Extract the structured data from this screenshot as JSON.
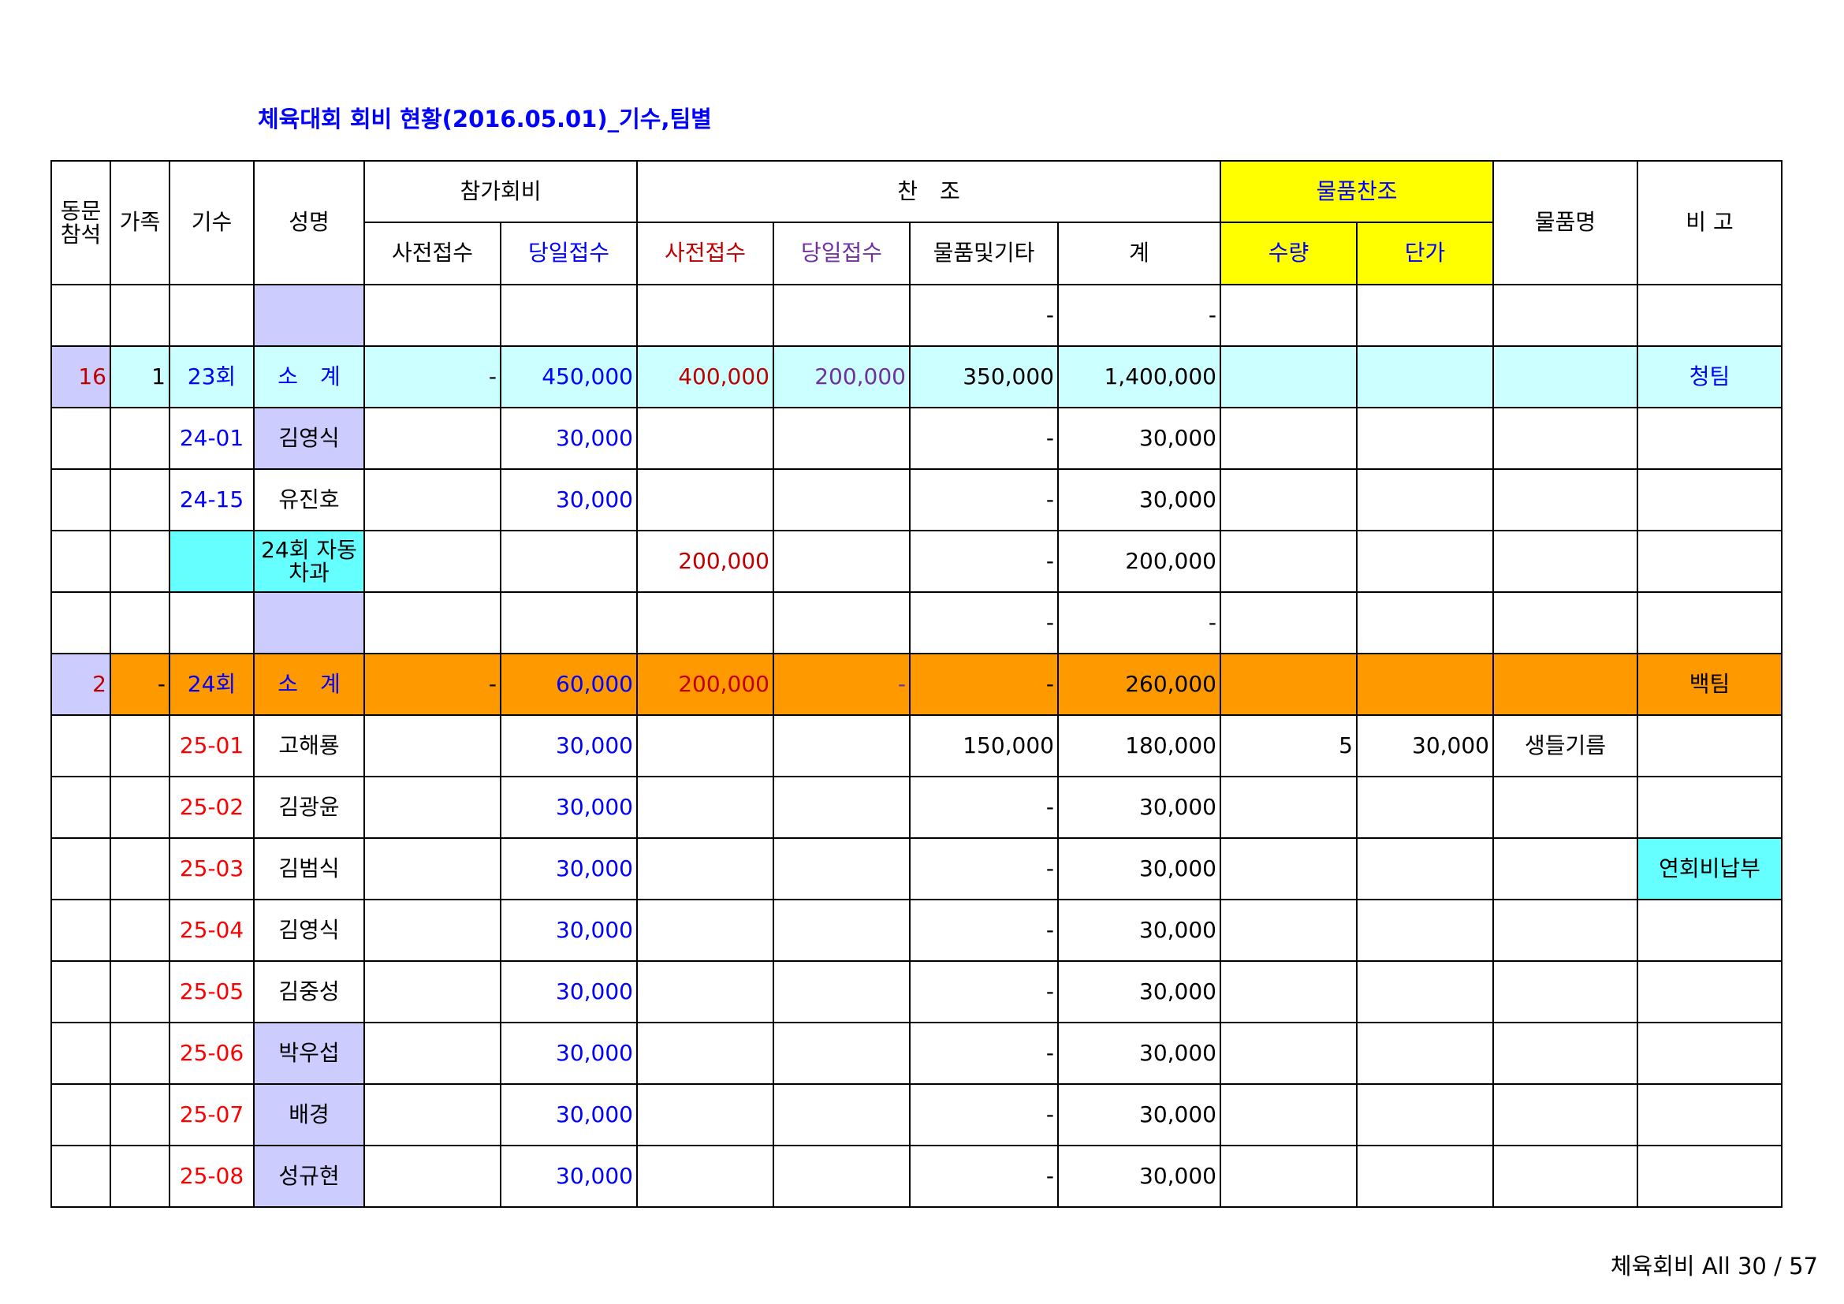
{
  "title": "체육대회 회비 현황(2016.05.01)_기수,팀별",
  "headers": {
    "attend": "동문\n참석",
    "family": "가족",
    "gisu": "기수",
    "name": "성명",
    "fee_group": "참가회비",
    "fee_pre": "사전접수",
    "fee_day": "당일접수",
    "sponsor_group": "찬　조",
    "sp_pre": "사전접수",
    "sp_day": "당일접수",
    "sp_goods": "물품및기타",
    "sp_total": "계",
    "goods_group": "물품찬조",
    "qty": "수량",
    "unit_price": "단가",
    "goods_name": "물품명",
    "remark": "비 고"
  },
  "rows": [
    {
      "a": "",
      "f": "",
      "g": "",
      "n": "",
      "fp": "",
      "fd": "",
      "sp": "",
      "sd": "",
      "go": "-",
      "t": "-",
      "q": "",
      "u": "",
      "gn": "",
      "rm": ""
    },
    {
      "a": "16",
      "f": "1",
      "g": "23회",
      "n": "소　계",
      "fp": "-",
      "fd": "450,000",
      "sp": "400,000",
      "sd": "200,000",
      "go": "350,000",
      "t": "1,400,000",
      "q": "",
      "u": "",
      "gn": "",
      "rm": "청팀"
    },
    {
      "a": "",
      "f": "",
      "g": "24-01",
      "n": "김영식",
      "fp": "",
      "fd": "30,000",
      "sp": "",
      "sd": "",
      "go": "-",
      "t": "30,000",
      "q": "",
      "u": "",
      "gn": "",
      "rm": ""
    },
    {
      "a": "",
      "f": "",
      "g": "24-15",
      "n": "유진호",
      "fp": "",
      "fd": "30,000",
      "sp": "",
      "sd": "",
      "go": "-",
      "t": "30,000",
      "q": "",
      "u": "",
      "gn": "",
      "rm": ""
    },
    {
      "a": "",
      "f": "",
      "g": "",
      "n": "24회\n자동차과",
      "fp": "",
      "fd": "",
      "sp": "200,000",
      "sd": "",
      "go": "-",
      "t": "200,000",
      "q": "",
      "u": "",
      "gn": "",
      "rm": ""
    },
    {
      "a": "",
      "f": "",
      "g": "",
      "n": "",
      "fp": "",
      "fd": "",
      "sp": "",
      "sd": "",
      "go": "-",
      "t": "-",
      "q": "",
      "u": "",
      "gn": "",
      "rm": ""
    },
    {
      "a": "2",
      "f": "-",
      "g": "24회",
      "n": "소　계",
      "fp": "-",
      "fd": "60,000",
      "sp": "200,000",
      "sd": "-",
      "go": "-",
      "t": "260,000",
      "q": "",
      "u": "",
      "gn": "",
      "rm": "백팀"
    },
    {
      "a": "",
      "f": "",
      "g": "25-01",
      "n": "고해룡",
      "fp": "",
      "fd": "30,000",
      "sp": "",
      "sd": "",
      "go": "150,000",
      "t": "180,000",
      "q": "5",
      "u": "30,000",
      "gn": "생들기름",
      "rm": ""
    },
    {
      "a": "",
      "f": "",
      "g": "25-02",
      "n": "김광윤",
      "fp": "",
      "fd": "30,000",
      "sp": "",
      "sd": "",
      "go": "-",
      "t": "30,000",
      "q": "",
      "u": "",
      "gn": "",
      "rm": ""
    },
    {
      "a": "",
      "f": "",
      "g": "25-03",
      "n": "김범식",
      "fp": "",
      "fd": "30,000",
      "sp": "",
      "sd": "",
      "go": "-",
      "t": "30,000",
      "q": "",
      "u": "",
      "gn": "",
      "rm": "연회비납부"
    },
    {
      "a": "",
      "f": "",
      "g": "25-04",
      "n": "김영식",
      "fp": "",
      "fd": "30,000",
      "sp": "",
      "sd": "",
      "go": "-",
      "t": "30,000",
      "q": "",
      "u": "",
      "gn": "",
      "rm": ""
    },
    {
      "a": "",
      "f": "",
      "g": "25-05",
      "n": "김중성",
      "fp": "",
      "fd": "30,000",
      "sp": "",
      "sd": "",
      "go": "-",
      "t": "30,000",
      "q": "",
      "u": "",
      "gn": "",
      "rm": ""
    },
    {
      "a": "",
      "f": "",
      "g": "25-06",
      "n": "박우섭",
      "fp": "",
      "fd": "30,000",
      "sp": "",
      "sd": "",
      "go": "-",
      "t": "30,000",
      "q": "",
      "u": "",
      "gn": "",
      "rm": ""
    },
    {
      "a": "",
      "f": "",
      "g": "25-07",
      "n": "배경",
      "fp": "",
      "fd": "30,000",
      "sp": "",
      "sd": "",
      "go": "-",
      "t": "30,000",
      "q": "",
      "u": "",
      "gn": "",
      "rm": ""
    },
    {
      "a": "",
      "f": "",
      "g": "25-08",
      "n": "성규현",
      "fp": "",
      "fd": "30,000",
      "sp": "",
      "sd": "",
      "go": "-",
      "t": "30,000",
      "q": "",
      "u": "",
      "gn": "",
      "rm": ""
    }
  ],
  "footer": "체육회비 All 30 / 57"
}
